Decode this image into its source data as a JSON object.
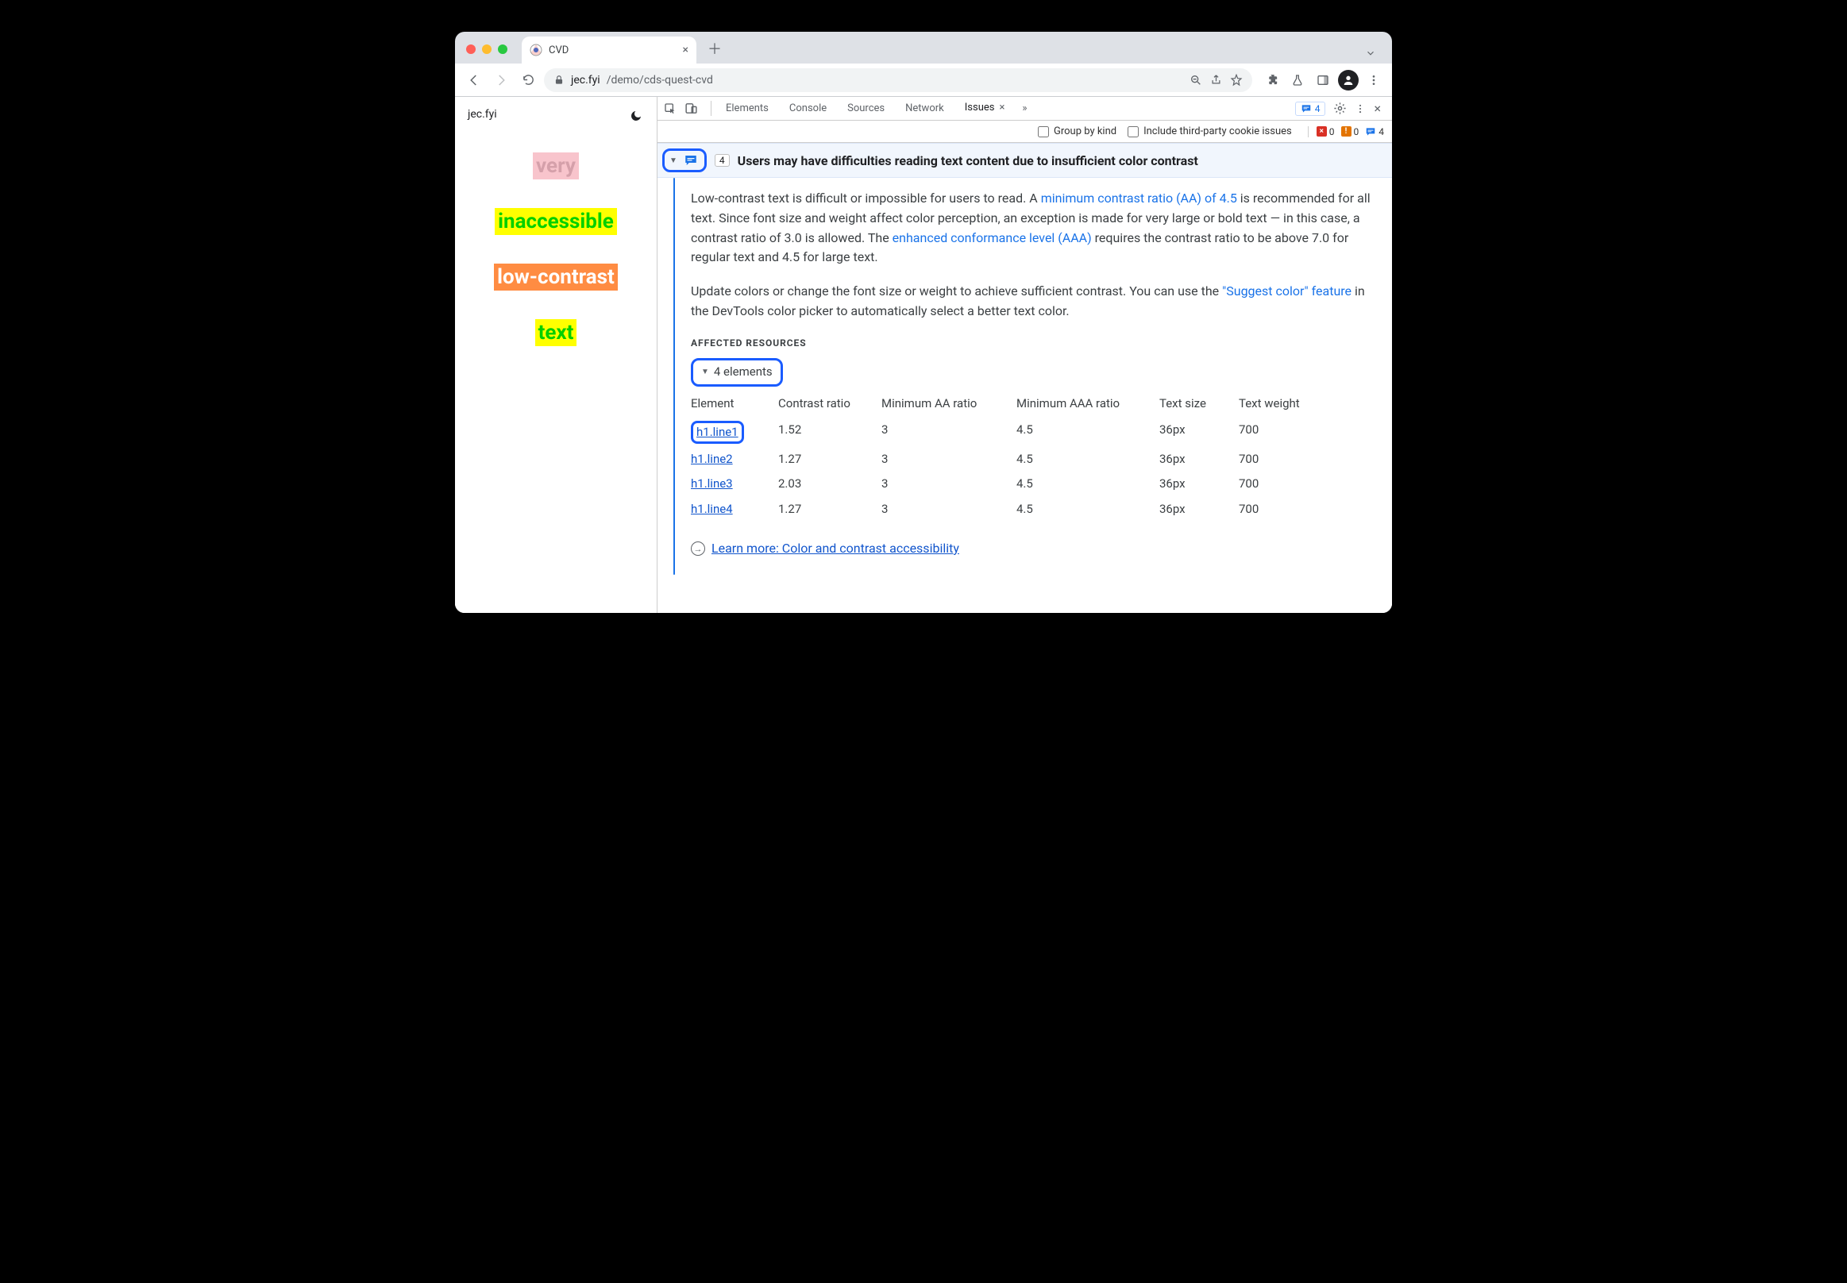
{
  "browser": {
    "tab_title": "CVD",
    "url_host": "jec.fyi",
    "url_path": "/demo/cds-quest-cvd"
  },
  "page": {
    "brand": "jec.fyi",
    "lines": [
      "very",
      "inaccessible",
      "low-contrast",
      "text"
    ]
  },
  "devtools": {
    "tabs": [
      "Elements",
      "Console",
      "Sources",
      "Network",
      "Issues"
    ],
    "active_tab": "Issues",
    "badge_count": "4",
    "toolbar": {
      "group_label": "Group by kind",
      "include_label": "Include third-party cookie issues",
      "red_count": "0",
      "orange_count": "0",
      "blue_count": "4"
    }
  },
  "issue": {
    "count": "4",
    "title": "Users may have difficulties reading text content due to insufficient color contrast",
    "p1_a": "Low-contrast text is difficult or impossible for users to read. A ",
    "p1_link1": "minimum contrast ratio (AA) of 4.5",
    "p1_b": " is recommended for all text. Since font size and weight affect color perception, an exception is made for very large or bold text — in this case, a contrast ratio of 3.0 is allowed. The ",
    "p1_link2": "enhanced conformance level (AAA)",
    "p1_c": " requires the contrast ratio to be above 7.0 for regular text and 4.5 for large text.",
    "p2_a": "Update colors or change the font size or weight to achieve sufficient contrast. You can use the ",
    "p2_link": "\"Suggest color\" feature",
    "p2_b": " in the DevTools color picker to automatically select a better text color.",
    "affected_heading": "AFFECTED RESOURCES",
    "elements_label": "4 elements",
    "columns": [
      "Element",
      "Contrast ratio",
      "Minimum AA ratio",
      "Minimum AAA ratio",
      "Text size",
      "Text weight"
    ],
    "rows": [
      {
        "elem": "h1.line1",
        "cr": "1.52",
        "aa": "3",
        "aaa": "4.5",
        "size": "36px",
        "weight": "700"
      },
      {
        "elem": "h1.line2",
        "cr": "1.27",
        "aa": "3",
        "aaa": "4.5",
        "size": "36px",
        "weight": "700"
      },
      {
        "elem": "h1.line3",
        "cr": "2.03",
        "aa": "3",
        "aaa": "4.5",
        "size": "36px",
        "weight": "700"
      },
      {
        "elem": "h1.line4",
        "cr": "1.27",
        "aa": "3",
        "aaa": "4.5",
        "size": "36px",
        "weight": "700"
      }
    ],
    "learn_more": "Learn more: Color and contrast accessibility"
  }
}
